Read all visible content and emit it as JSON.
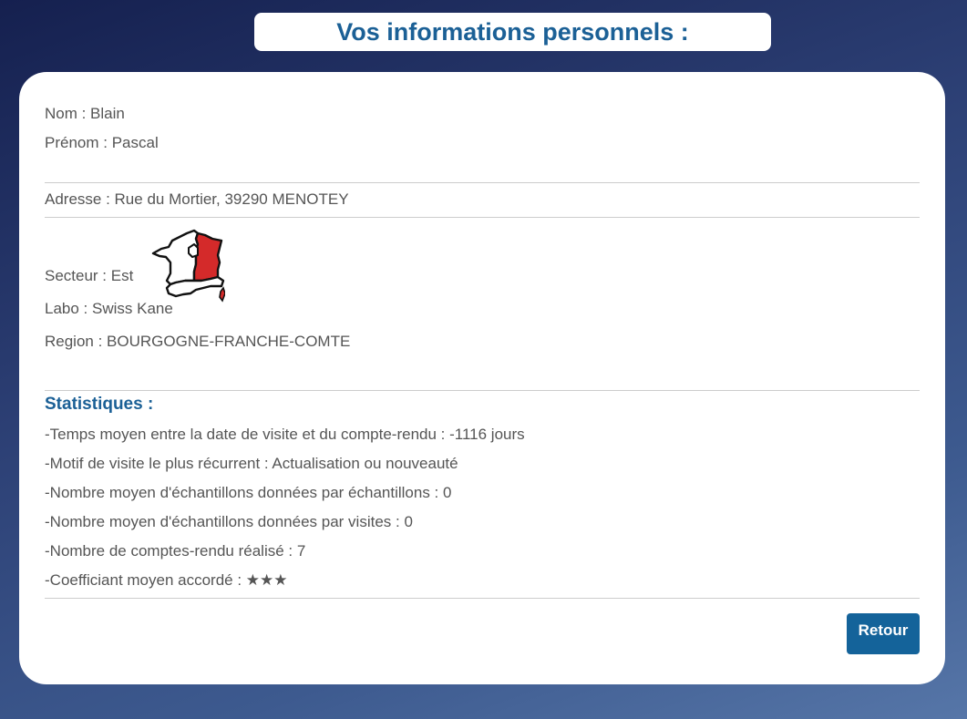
{
  "header": {
    "title": "Vos informations personnels :"
  },
  "identity": {
    "nom": "Nom : Blain",
    "prenom": "Prénom : Pascal"
  },
  "address": {
    "text": "Adresse : Rue du Mortier, 39290 MENOTEY"
  },
  "sector": {
    "secteur": "Secteur : Est",
    "labo": "Labo : Swiss Kane",
    "region": "Region : BOURGOGNE-FRANCHE-COMTE",
    "map_icon": "france-map-east-highlighted-icon"
  },
  "statistics": {
    "title": "Statistiques :",
    "lines": [
      "-Temps moyen entre la date de visite et du compte-rendu : -1116 jours",
      "-Motif de visite le plus récurrent : Actualisation ou nouveauté",
      "-Nombre moyen d'échantillons données par échantillons : 0",
      "-Nombre moyen d'échantillons données par visites : 0",
      "-Nombre de comptes-rendu réalisé : 7",
      "-Coefficiant moyen accordé : ★★★"
    ]
  },
  "actions": {
    "back_label": "Retour"
  },
  "colors": {
    "accent": "#1b6096",
    "button": "#14639a",
    "text": "#555555",
    "highlight_region": "#d42a2a"
  }
}
